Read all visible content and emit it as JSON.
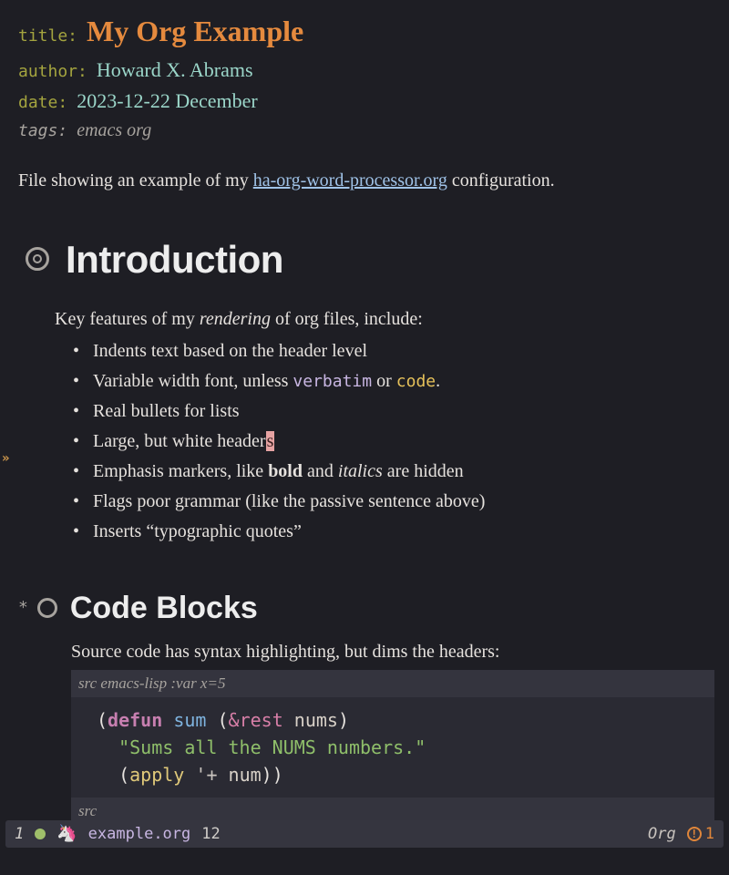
{
  "meta": {
    "title_key": "title:",
    "title_val": "My Org Example",
    "author_key": "author:",
    "author_val": "Howard X. Abrams",
    "date_key": "date:",
    "date_val": "2023-12-22 December",
    "tags_key": "tags:",
    "tags_val": "emacs org"
  },
  "intro": {
    "before": "File showing an example of my ",
    "link": "ha-org-word-processor.org",
    "after": " configuration."
  },
  "sections": {
    "h1": "Introduction",
    "h2": "Code Blocks"
  },
  "body1": {
    "lead_a": "Key features of my ",
    "lead_em": "rendering",
    "lead_b": " of org files, include:"
  },
  "features": [
    {
      "text": "Indents text based on the header level"
    },
    {
      "pre": "Variable width font, unless ",
      "verb": "verbatim",
      "mid": " or ",
      "code": "code",
      "post": "."
    },
    {
      "text": "Real bullets for lists"
    },
    {
      "pre": "Large, but white header",
      "cursor": "s"
    },
    {
      "pre": "Emphasis markers, like ",
      "bold": "bold",
      "mid": " and ",
      "ital": "italics",
      "post": " are hidden"
    },
    {
      "text": "Flags poor grammar (like the passive sentence above)"
    },
    {
      "text": "Inserts “typographic quotes”"
    }
  ],
  "src": {
    "desc": "Source code has syntax highlighting, but dims the headers:",
    "header_pre": "src ",
    "header_lang": "emacs-lisp :var x=5",
    "footer": "src",
    "code": {
      "l1_open": "(",
      "l1_defun": "defun",
      "l1_sp": " ",
      "l1_name": "sum",
      "l1_args_open": " (",
      "l1_rest": "&rest",
      "l1_arg": " nums",
      "l1_args_close": ")",
      "l2_str": "\"Sums all the NUMS numbers.\"",
      "l3_open": "(",
      "l3_apply": "apply",
      "l3_sp": " ",
      "l3_quote": "'+",
      "l3_arg": " num",
      "l3_close": "))"
    }
  },
  "modeline": {
    "win": "1",
    "file": "example.org",
    "line": "12",
    "mode": "Org",
    "warn_count": "1"
  }
}
